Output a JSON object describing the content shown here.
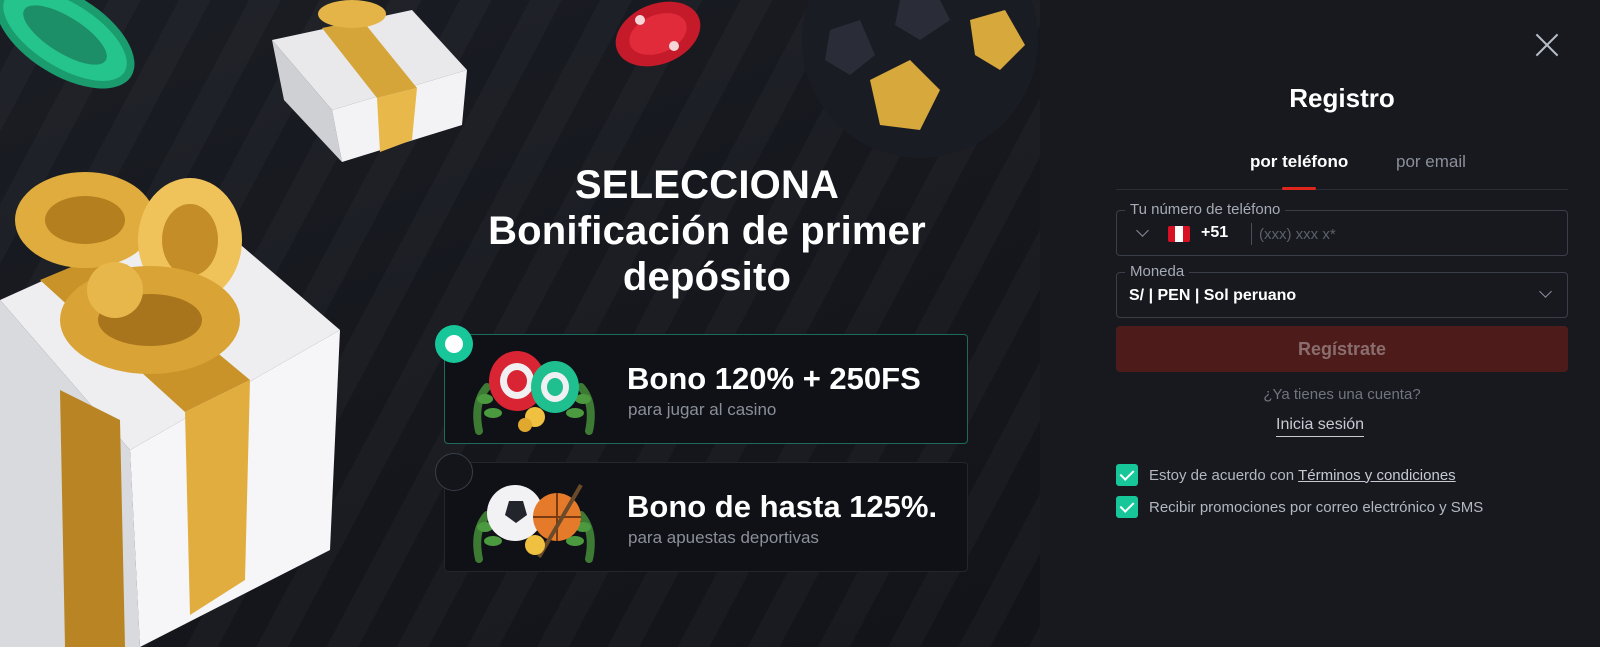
{
  "promo": {
    "headline": {
      "line1": "SELECCIONA",
      "line2": "Bonificación de primer",
      "line3": "depósito"
    },
    "bonuses": [
      {
        "title": "Bono 120% + 250FS",
        "subtitle": "para jugar al casino",
        "selected": true,
        "icon": "casino-chips-icon"
      },
      {
        "title": "Bono de hasta 125%.",
        "subtitle": "para apuestas deportivas",
        "selected": false,
        "icon": "sports-balls-icon"
      }
    ],
    "colors": {
      "accent": "#17c79a",
      "background": "#16181e"
    }
  },
  "registration": {
    "title": "Registro",
    "tabs": [
      {
        "label": "por teléfono",
        "active": true
      },
      {
        "label": "por email",
        "active": false
      }
    ],
    "phone": {
      "label": "Tu número de teléfono",
      "dial_code": "+51",
      "flag": "peru-flag-icon",
      "placeholder": "(xxx) xxx x*"
    },
    "currency": {
      "label": "Moneda",
      "value": "S/ | PEN | Sol peruano"
    },
    "submit_label": "Regístrate",
    "have_account": "¿Ya tienes una cuenta?",
    "login_label": "Inicia sesión",
    "checkboxes": [
      {
        "text": "Estoy de acuerdo con",
        "link": "Términos y condiciones",
        "checked": true
      },
      {
        "text": "Recibir promociones por correo electrónico y SMS",
        "checked": true
      }
    ],
    "colors": {
      "brand_red": "#e0261a",
      "button_disabled": "#4d1b1a",
      "check": "#17c79a"
    }
  }
}
